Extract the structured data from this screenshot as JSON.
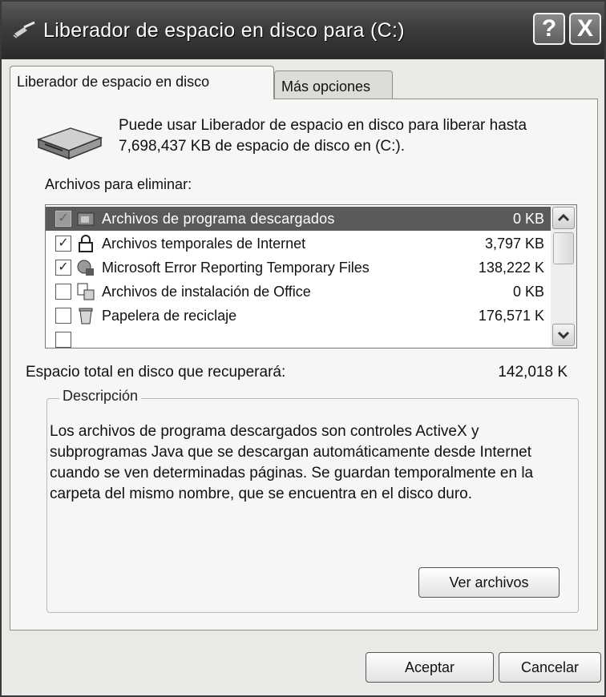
{
  "window": {
    "title": "Liberador de espacio en disco para  (C:)",
    "help_glyph": "?",
    "close_glyph": "X"
  },
  "tabs": [
    {
      "label": "Liberador de espacio en disco",
      "active": true
    },
    {
      "label": "Más opciones",
      "active": false
    }
  ],
  "intro": {
    "line1": "Puede usar Liberador de espacio en disco para liberar hasta",
    "line2": "7,698,437 KB de espacio de disco en  (C:)."
  },
  "files_label": "Archivos para eliminar:",
  "files": [
    {
      "name": "Archivos de programa descargados",
      "size": "0 KB",
      "checked": true,
      "selected": true,
      "icon": "downloaded-program-files-icon"
    },
    {
      "name": "Archivos temporales de Internet",
      "size": "3,797 KB",
      "checked": true,
      "selected": false,
      "icon": "lock-icon"
    },
    {
      "name": "Microsoft Error Reporting Temporary Files",
      "size": "138,222 K",
      "checked": true,
      "selected": false,
      "icon": "error-reporting-icon"
    },
    {
      "name": "Archivos de instalación de Office",
      "size": "0 KB",
      "checked": false,
      "selected": false,
      "icon": "office-setup-icon"
    },
    {
      "name": "Papelera de reciclaje",
      "size": "176,571 K",
      "checked": false,
      "selected": false,
      "icon": "recycle-bin-icon"
    }
  ],
  "total": {
    "label": "Espacio total en disco que recuperará:",
    "value": "142,018 K"
  },
  "description": {
    "legend": "Descripción",
    "text": "Los archivos de programa descargados son controles ActiveX y subprogramas Java que se descargan automáticamente desde Internet cuando se ven determinadas páginas. Se guardan temporalmente en la carpeta del mismo nombre, que se encuentra en el disco duro."
  },
  "buttons": {
    "view_files": "Ver archivos",
    "ok": "Aceptar",
    "cancel": "Cancelar"
  }
}
